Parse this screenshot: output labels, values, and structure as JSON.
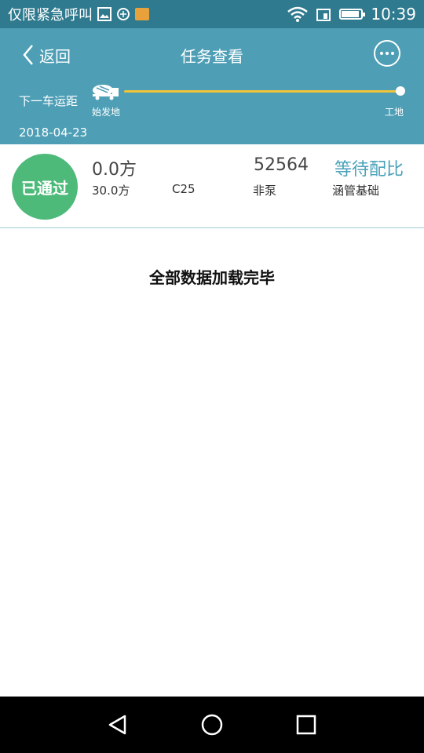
{
  "status_bar": {
    "carrier": "仅限紧急呼叫",
    "time": "10:39",
    "battery_level": 0.9
  },
  "header": {
    "back_label": "返回",
    "title": "任务查看",
    "distance_label": "下一车运距",
    "origin_label": "始发地",
    "destination_label": "工地",
    "date": "2018-04-23"
  },
  "task": {
    "status_badge": "已通过",
    "delivered_volume": "0.0方",
    "total_volume": "30.0方",
    "grade": "C25",
    "number": "52564",
    "pump_type": "非泵",
    "status": "等待配比",
    "part": "涵管基础"
  },
  "list": {
    "load_complete": "全部数据加载完毕"
  },
  "colors": {
    "status_bar_bg": "#2f7a8e",
    "header_bg": "#4e9fb6",
    "badge_green": "#4dba7a",
    "accent_teal": "#4aa1b9",
    "route_yellow": "#f0c43a"
  }
}
